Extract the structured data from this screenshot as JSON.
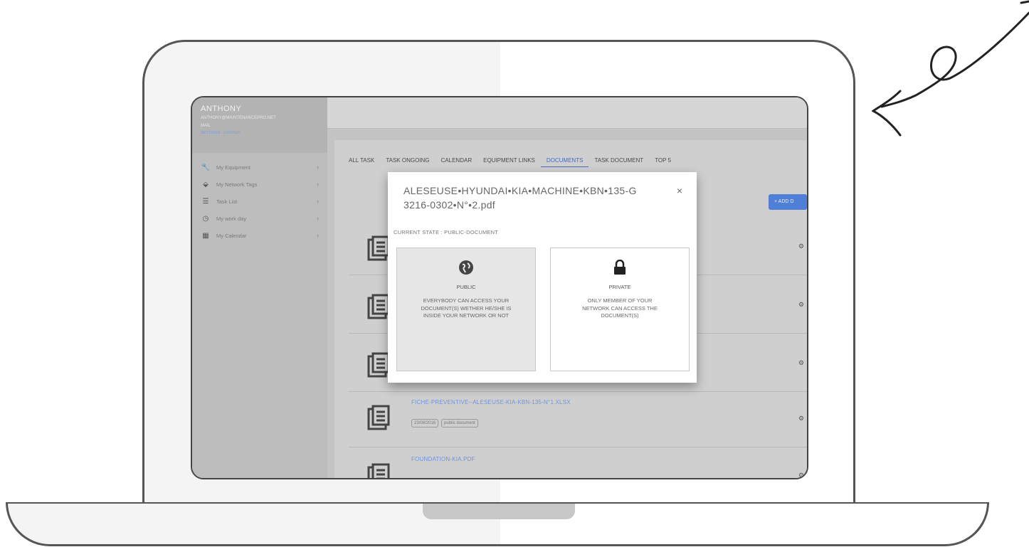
{
  "sidebar": {
    "profile_name": "ANTHONY",
    "profile_sub": "",
    "profile_email": "ANTHONY@MAINTENANCEPRO.NET",
    "profile_line": "MAIL",
    "profile_link": "SETTINGS · LOGOUT",
    "items": [
      {
        "icon": "wrench-icon",
        "glyph": "🔧",
        "label": "My Equipment"
      },
      {
        "icon": "tag-icon",
        "glyph": "⬙",
        "label": "My Network Tags"
      },
      {
        "icon": "list-icon",
        "glyph": "☰",
        "label": "Task List"
      },
      {
        "icon": "clock-icon",
        "glyph": "◷",
        "label": "My work day"
      },
      {
        "icon": "calendar-icon",
        "glyph": "▦",
        "label": "My Calendar"
      }
    ],
    "arrow": "›"
  },
  "tabs": [
    "ALL TASK",
    "TASK ONGOING",
    "CALENDAR",
    "EQUIPMENT LINKS",
    "DOCUMENTS",
    "TASK DOCUMENT",
    "TOP 5"
  ],
  "active_tab": "DOCUMENTS",
  "add_button": "+ ADD D",
  "documents": [
    {
      "title": "",
      "date": "",
      "state": ""
    },
    {
      "title": "",
      "date": "",
      "state": ""
    },
    {
      "title": "",
      "date": "",
      "state": ""
    },
    {
      "title": "FICHE-PREVENTIVE--ALESEUSE-KIA-KBN-135-N°1.XLSX",
      "date": "23/08/2016",
      "state": "public document"
    },
    {
      "title": "FOUNDATION-KIA.PDF",
      "date": "",
      "state": ""
    }
  ],
  "modal": {
    "title": "ALESEUSE•HYUNDAI•KIA•MACHINE•KBN•135-G3216-0302•N°•2.pdf",
    "close": "×",
    "state": "CURRENT STATE : PUBLIC-DOCUMENT",
    "public": {
      "icon": "globe-icon",
      "title": "PUBLIC",
      "desc": "EVERYBODY CAN ACCESS YOUR DOCUMENT(S) WETHER HE/SHE IS INSIDE YOUR NETWORK OR NOT"
    },
    "private": {
      "icon": "lock-icon",
      "title": "PRIVATE",
      "desc": "ONLY MEMBER OF YOUR NETWORK CAN ACCESS THE DOCUMENT(S)"
    }
  }
}
